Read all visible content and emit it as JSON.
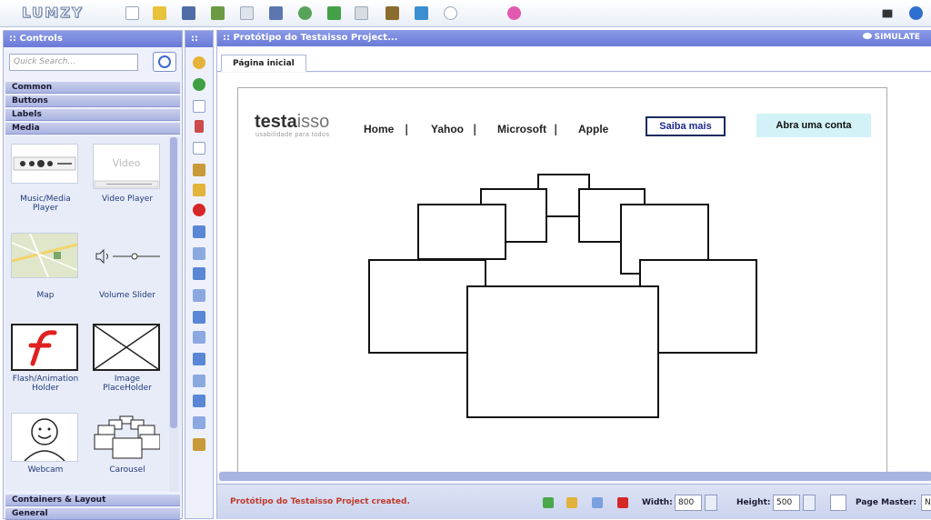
{
  "app": {
    "logo": "LUMZY"
  },
  "controls_panel": {
    "header": ":: Controls",
    "search_placeholder": "Quick Search...",
    "categories_top": [
      "Common",
      "Buttons",
      "Labels",
      "Media"
    ],
    "categories_bottom": [
      "Containers & Layout",
      "General"
    ],
    "items": [
      {
        "label": "Music/Media Player",
        "icon": "media-player-icon"
      },
      {
        "label": "Video Player",
        "icon": "video-player-icon",
        "thumb_text": "Video"
      },
      {
        "label": "Map",
        "icon": "map-icon"
      },
      {
        "label": "Volume Slider",
        "icon": "volume-slider-icon"
      },
      {
        "label": "Flash/Animation Holder",
        "icon": "flash-icon"
      },
      {
        "label": "Image PlaceHolder",
        "icon": "image-placeholder-icon"
      },
      {
        "label": "Webcam",
        "icon": "webcam-icon"
      },
      {
        "label": "Carousel",
        "icon": "carousel-icon"
      }
    ]
  },
  "tools_panel": {
    "header": "::"
  },
  "main_panel": {
    "header": ":: Protótipo do Testaisso Project...",
    "simulate_label": "SIMULATE",
    "tab_label": "Página inicial"
  },
  "mockup": {
    "brand_bold": "testa",
    "brand_light": "isso",
    "tagline": "usabilidade para todos",
    "nav": [
      "Home",
      "Yahoo",
      "Microsoft",
      "Apple"
    ],
    "separator": "|",
    "button_saiba": "Saiba mais",
    "button_abra": "Abra uma conta"
  },
  "status_bar": {
    "message": "Protótipo do Testaisso Project created.",
    "width_label": "Width:",
    "width_value": "800",
    "height_label": "Height:",
    "height_value": "500",
    "page_master_label": "Page Master:",
    "page_master_value": "N"
  },
  "colors": {
    "accent": "#6a7bd8",
    "status_message": "#c0392b",
    "abra_bg": "#d3f2f8"
  }
}
